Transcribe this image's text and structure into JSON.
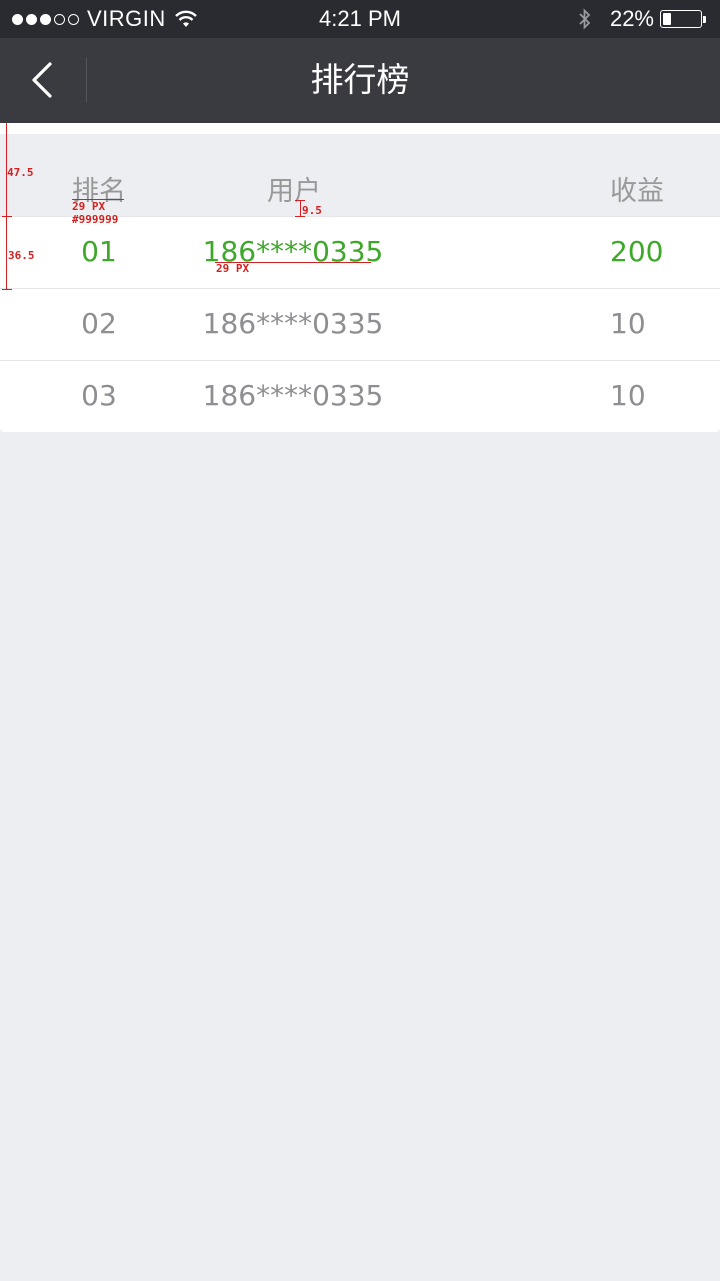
{
  "status_bar": {
    "carrier": "VIRGIN",
    "time": "4:21 PM",
    "battery": "22%",
    "battery_level": 0.22,
    "icons": [
      "signal-dots-icon",
      "wifi-icon",
      "bluetooth-icon",
      "battery-icon"
    ]
  },
  "nav": {
    "title": "排行榜",
    "back_icon": "chevron-left-icon"
  },
  "table": {
    "headers": {
      "rank": "排名",
      "user": "用户",
      "income": "收益"
    },
    "rows": [
      {
        "rank": "01",
        "user": "186****0335",
        "income": "200",
        "highlight": true
      },
      {
        "rank": "02",
        "user": "186****0335",
        "income": "10",
        "highlight": false
      },
      {
        "rank": "03",
        "user": "186****0335",
        "income": "10",
        "highlight": false
      }
    ]
  },
  "annotations": {
    "a1": "47.5",
    "a2": "36.5",
    "a3": "29 PX",
    "a4": "#999999",
    "a5": "9.5",
    "a6": "29 PX"
  },
  "colors": {
    "nav_bg": "#3a3b40",
    "status_bg": "#2a2b30",
    "page_bg": "#edeef2",
    "header_text": "#999999",
    "row_text": "#8e8e93",
    "highlight": "#3ea82a",
    "annotation": "#d42020"
  }
}
